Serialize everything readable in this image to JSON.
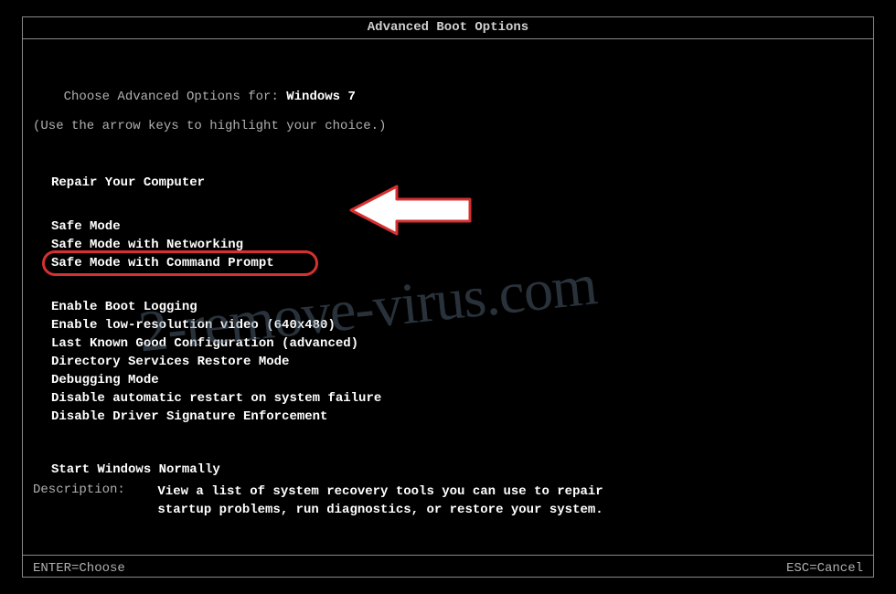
{
  "title": "Advanced Boot Options",
  "intro": {
    "prefix": "Choose Advanced Options for: ",
    "os": "Windows 7",
    "hint": "(Use the arrow keys to highlight your choice.)"
  },
  "sections": {
    "repair": "Repair Your Computer",
    "safe": {
      "mode": "Safe Mode",
      "networking": "Safe Mode with Networking",
      "command": "Safe Mode with Command Prompt"
    },
    "advanced": {
      "boot_logging": "Enable Boot Logging",
      "low_res": "Enable low-resolution video (640x480)",
      "last_known": "Last Known Good Configuration (advanced)",
      "ds_restore": "Directory Services Restore Mode",
      "debugging": "Debugging Mode",
      "disable_restart": "Disable automatic restart on system failure",
      "disable_driver_sig": "Disable Driver Signature Enforcement"
    },
    "normal": "Start Windows Normally"
  },
  "description": {
    "label": "Description:",
    "text": "View a list of system recovery tools you can use to repair startup problems, run diagnostics, or restore your system."
  },
  "footer": {
    "enter": "ENTER=Choose",
    "esc": "ESC=Cancel"
  },
  "watermark": "2-remove-virus.com",
  "annotations": {
    "highlighted_option": "Safe Mode with Command Prompt",
    "arrow_color": "#ffffff",
    "arrow_border": "#d63030",
    "oval_color": "#d63030"
  }
}
